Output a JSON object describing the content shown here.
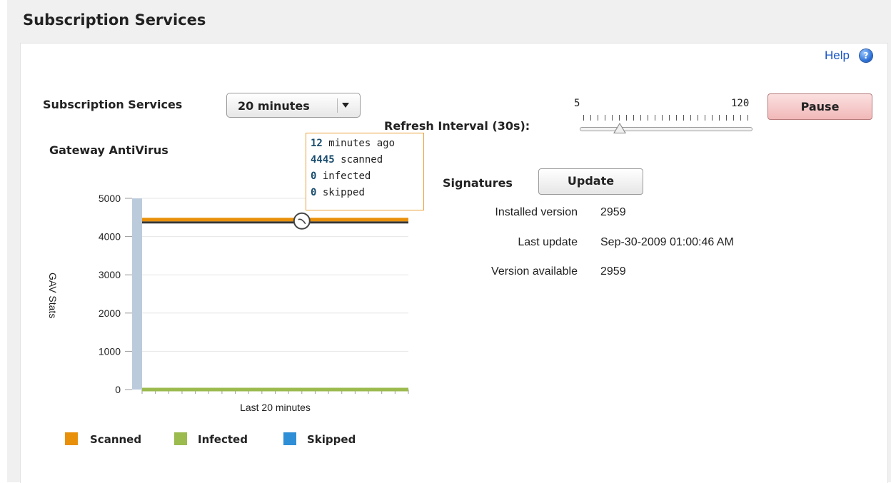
{
  "page": {
    "section_title": "Subscription Services",
    "help_label": "Help",
    "help_icon_glyph": "?"
  },
  "controls": {
    "services_label": "Subscription Services",
    "interval_select_value": "20 minutes",
    "refresh_label": "Refresh Interval (30s):",
    "slider_min_label": "5",
    "slider_max_label": "120",
    "slider_value": 30,
    "slider_min": 5,
    "slider_max": 120,
    "pause_label": "Pause"
  },
  "gav": {
    "title": "Gateway AntiVirus",
    "tooltip": {
      "minutes_ago_value": "12",
      "minutes_ago_label": " minutes ago",
      "scanned_value": "4445",
      "scanned_label": " scanned",
      "infected_value": "0",
      "infected_label": " infected",
      "skipped_value": "0",
      "skipped_label": " skipped"
    }
  },
  "signatures": {
    "label": "Signatures",
    "update_label": "Update",
    "rows": [
      {
        "label": "Installed version",
        "value": "2959"
      },
      {
        "label": "Last update",
        "value": "Sep-30-2009 01:00:46 AM"
      },
      {
        "label": "Version available",
        "value": "2959"
      }
    ]
  },
  "chart_data": {
    "type": "line",
    "xlabel": "Last 20 minutes",
    "ylabel": "GAV Stats",
    "ylim": [
      0,
      5000
    ],
    "yticks": [
      0,
      1000,
      2000,
      3000,
      4000,
      5000
    ],
    "x": [
      0,
      20
    ],
    "series": [
      {
        "name": "Scanned",
        "values": [
          4445,
          4445
        ],
        "color": "#e8900a"
      },
      {
        "name": "Infected",
        "values": [
          0,
          0
        ],
        "color": "#9bbb4f"
      },
      {
        "name": "Skipped",
        "values": [
          0,
          0
        ],
        "color": "#2e8fd6"
      }
    ],
    "highlight_x": 12,
    "grid": true,
    "legend_position": "bottom"
  },
  "colors": {
    "scanned": "#e8900a",
    "infected": "#9bbb4f",
    "skipped": "#2e8fd6",
    "pause_button": "#f1b8b8",
    "tooltip_border": "#e8a23a"
  }
}
